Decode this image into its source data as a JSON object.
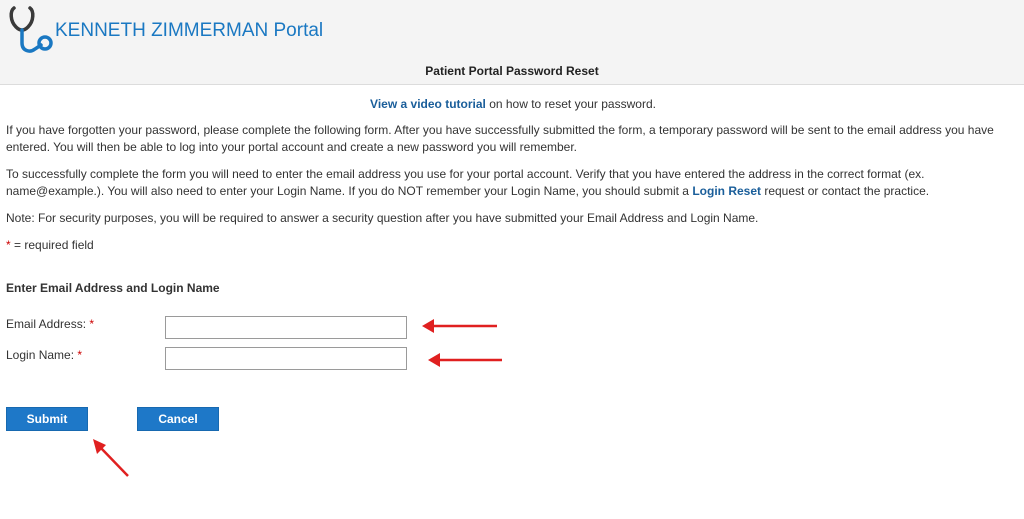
{
  "header": {
    "portal_title": "KENNETH ZIMMERMAN Portal",
    "logo_icon": "stethoscope-icon",
    "brand_color": "#1a78c2"
  },
  "page": {
    "title": "Patient Portal Password Reset"
  },
  "tutorial": {
    "link_label": "View a video tutorial",
    "rest": " on how to reset your password."
  },
  "instructions": {
    "para1": "If you have forgotten your password, please complete the following form. After you have successfully submitted the form, a temporary password will be sent to the email address you have entered. You will then be able to log into your portal account and create a new password you will remember.",
    "para2_before": "To successfully complete the form you will need to enter the email address you use for your portal account. Verify that you have entered the address in the correct format (ex. name@example.). You will also need to enter your Login Name. If you do NOT remember your Login Name, you should submit a ",
    "para2_link": "Login Reset",
    "para2_after": " request or contact the practice.",
    "note": "Note: For security purposes, you will be required to answer a security question after you have submitted your Email Address and Login Name.",
    "required_star": "*",
    "required_text": " = required field"
  },
  "form": {
    "heading": "Enter Email Address and Login Name",
    "email_label": "Email Address:",
    "email_value": "",
    "login_label": "Login Name:",
    "login_value": "",
    "required_star": "*"
  },
  "buttons": {
    "submit": "Submit",
    "cancel": "Cancel",
    "color": "#1e78c8"
  },
  "annotations": {
    "arrow_color": "#e02020"
  }
}
